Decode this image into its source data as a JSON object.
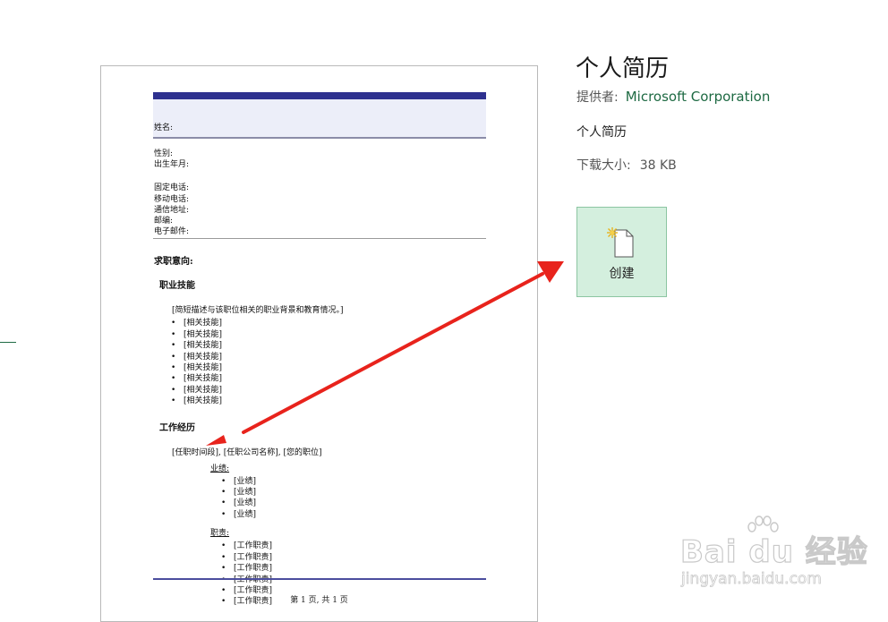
{
  "template": {
    "title": "个人简历",
    "provider_label": "提供者:",
    "provider": "Microsoft Corporation",
    "description": "个人简历",
    "size_label": "下载大小:",
    "size": "38 KB",
    "create_label": "创建",
    "create_icon": "new-document-icon"
  },
  "preview": {
    "name_label": "姓名:",
    "personal": [
      "性别:",
      "出生年月:"
    ],
    "contact": [
      "固定电话:",
      "移动电话:",
      "通信地址:",
      "邮编:",
      "电子邮件:"
    ],
    "objective": "求职意向:",
    "skills_heading": "职业技能",
    "skills_desc": "[简短描述与该职位相关的职业背景和教育情况。]",
    "skills": [
      "[相关技能]",
      "[相关技能]",
      "[相关技能]",
      "[相关技能]",
      "[相关技能]",
      "[相关技能]",
      "[相关技能]",
      "[相关技能]"
    ],
    "work_heading": "工作经历",
    "work_entry": "[任职时间段], [任职公司名称], [您的职位]",
    "achievements_label": "业绩:",
    "achievements": [
      "[业绩]",
      "[业绩]",
      "[业绩]",
      "[业绩]"
    ],
    "duties_label": "职责:",
    "duties": [
      "[工作职责]",
      "[工作职责]",
      "[工作职责]",
      "[工作职责]",
      "[工作职责]",
      "[工作职责]"
    ],
    "footer": "第 1 页, 共 1 页"
  },
  "annotation": {
    "arrow_color": "#e8231c"
  },
  "watermark": {
    "main": "Bai du 经验",
    "sub": "jingyan.baidu.com"
  }
}
